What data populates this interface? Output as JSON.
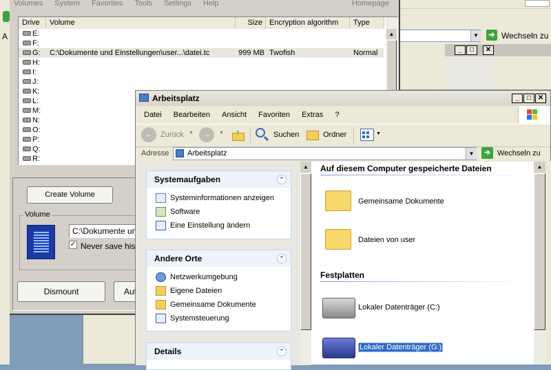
{
  "truecrypt": {
    "menu": [
      "Volumes",
      "System",
      "Favorites",
      "Tools",
      "Settings",
      "Help"
    ],
    "homepage": "Homepage",
    "columns": [
      "Drive",
      "Volume",
      "Size",
      "Encryption algorithm",
      "Type"
    ],
    "drives": [
      {
        "drive": "E:",
        "volume": "",
        "size": "",
        "algo": "",
        "type": ""
      },
      {
        "drive": "F:",
        "volume": "",
        "size": "",
        "algo": "",
        "type": ""
      },
      {
        "drive": "G:",
        "volume": "C:\\Dokumente und Einstellungen\\user...\\datei.tc",
        "size": "999 MB",
        "algo": "Twofish",
        "type": "Normal"
      },
      {
        "drive": "H:",
        "volume": "",
        "size": "",
        "algo": "",
        "type": ""
      },
      {
        "drive": "I:",
        "volume": "",
        "size": "",
        "algo": "",
        "type": ""
      },
      {
        "drive": "J:",
        "volume": "",
        "size": "",
        "algo": "",
        "type": ""
      },
      {
        "drive": "K:",
        "volume": "",
        "size": "",
        "algo": "",
        "type": ""
      },
      {
        "drive": "L:",
        "volume": "",
        "size": "",
        "algo": "",
        "type": ""
      },
      {
        "drive": "M:",
        "volume": "",
        "size": "",
        "algo": "",
        "type": ""
      },
      {
        "drive": "N:",
        "volume": "",
        "size": "",
        "algo": "",
        "type": ""
      },
      {
        "drive": "O:",
        "volume": "",
        "size": "",
        "algo": "",
        "type": ""
      },
      {
        "drive": "P:",
        "volume": "",
        "size": "",
        "algo": "",
        "type": ""
      },
      {
        "drive": "Q:",
        "volume": "",
        "size": "",
        "algo": "",
        "type": ""
      },
      {
        "drive": "R:",
        "volume": "",
        "size": "",
        "algo": "",
        "type": ""
      }
    ],
    "create_volume": "Create Volume",
    "volume_group": "Volume",
    "volume_path": "C:\\Dokumente und",
    "never_save": "Never save histo",
    "dismount": "Dismount",
    "automount": "Aut"
  },
  "back_window": {
    "left_letter": "A",
    "go_label": "Wechseln zu"
  },
  "explorer": {
    "title": "Arbeitsplatz",
    "menu": [
      "Datei",
      "Bearbeiten",
      "Ansicht",
      "Favoriten",
      "Extras",
      "?"
    ],
    "toolbar": {
      "back": "Zurück",
      "search": "Suchen",
      "folders": "Ordner"
    },
    "address_label": "Adresse",
    "address_value": "Arbeitsplatz",
    "go_label": "Wechseln zu",
    "tasks": {
      "title": "Systemaufgaben",
      "items": [
        "Systeminformationen anzeigen",
        "Software",
        "Eine Einstellung ändern"
      ]
    },
    "places": {
      "title": "Andere Orte",
      "items": [
        "Netzwerkumgebung",
        "Eigene Dateien",
        "Gemeinsame Dokumente",
        "Systemsteuerung"
      ]
    },
    "details": {
      "title": "Details"
    },
    "sections": {
      "stored": "Auf diesem Computer gespeicherte Dateien",
      "disks": "Festplatten"
    },
    "files": [
      "Gemeinsame Dokumente",
      "Dateien von user"
    ],
    "drives": [
      "Lokaler Datenträger (C:)",
      "Lokaler Datenträger (G:)"
    ]
  }
}
